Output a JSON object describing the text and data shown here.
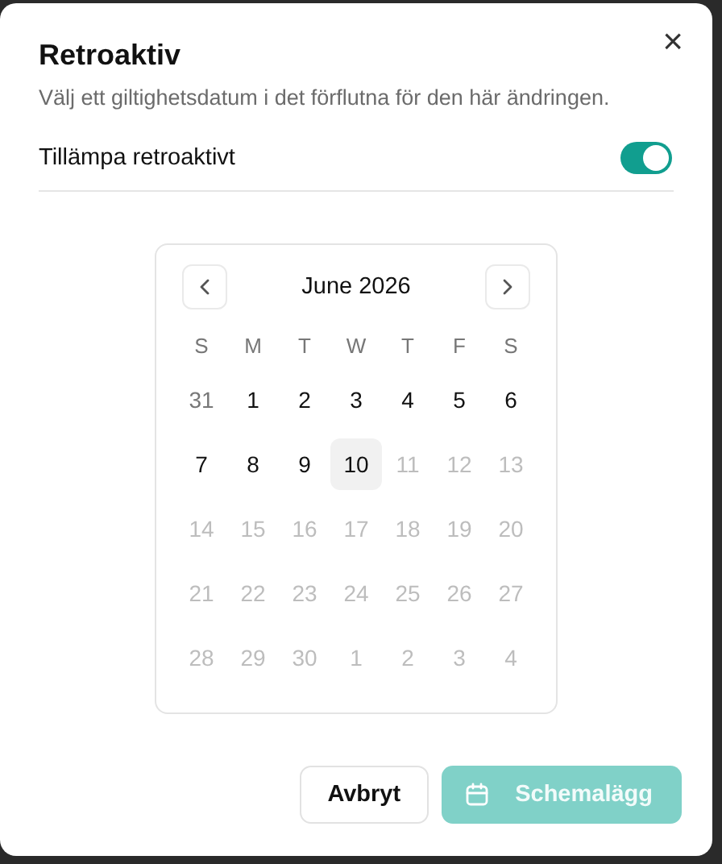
{
  "dialog": {
    "title": "Retroaktiv",
    "description": "Välj ett giltighetsdatum i det förflutna för den här ändringen.",
    "close": "×"
  },
  "toggle": {
    "label": "Tillämpa retroaktivt",
    "on": true
  },
  "calendar": {
    "month": "June 2026",
    "weekdays": [
      "S",
      "M",
      "T",
      "W",
      "T",
      "F",
      "S"
    ],
    "days": [
      {
        "label": "31",
        "outside": true,
        "disabled": false,
        "selected": false
      },
      {
        "label": "1",
        "outside": false,
        "disabled": false,
        "selected": false
      },
      {
        "label": "2",
        "outside": false,
        "disabled": false,
        "selected": false
      },
      {
        "label": "3",
        "outside": false,
        "disabled": false,
        "selected": false
      },
      {
        "label": "4",
        "outside": false,
        "disabled": false,
        "selected": false
      },
      {
        "label": "5",
        "outside": false,
        "disabled": false,
        "selected": false
      },
      {
        "label": "6",
        "outside": false,
        "disabled": false,
        "selected": false
      },
      {
        "label": "7",
        "outside": false,
        "disabled": false,
        "selected": false
      },
      {
        "label": "8",
        "outside": false,
        "disabled": false,
        "selected": false
      },
      {
        "label": "9",
        "outside": false,
        "disabled": false,
        "selected": false
      },
      {
        "label": "10",
        "outside": false,
        "disabled": false,
        "selected": true
      },
      {
        "label": "11",
        "outside": false,
        "disabled": true,
        "selected": false
      },
      {
        "label": "12",
        "outside": false,
        "disabled": true,
        "selected": false
      },
      {
        "label": "13",
        "outside": false,
        "disabled": true,
        "selected": false
      },
      {
        "label": "14",
        "outside": false,
        "disabled": true,
        "selected": false
      },
      {
        "label": "15",
        "outside": false,
        "disabled": true,
        "selected": false
      },
      {
        "label": "16",
        "outside": false,
        "disabled": true,
        "selected": false
      },
      {
        "label": "17",
        "outside": false,
        "disabled": true,
        "selected": false
      },
      {
        "label": "18",
        "outside": false,
        "disabled": true,
        "selected": false
      },
      {
        "label": "19",
        "outside": false,
        "disabled": true,
        "selected": false
      },
      {
        "label": "20",
        "outside": false,
        "disabled": true,
        "selected": false
      },
      {
        "label": "21",
        "outside": false,
        "disabled": true,
        "selected": false
      },
      {
        "label": "22",
        "outside": false,
        "disabled": true,
        "selected": false
      },
      {
        "label": "23",
        "outside": false,
        "disabled": true,
        "selected": false
      },
      {
        "label": "24",
        "outside": false,
        "disabled": true,
        "selected": false
      },
      {
        "label": "25",
        "outside": false,
        "disabled": true,
        "selected": false
      },
      {
        "label": "26",
        "outside": false,
        "disabled": true,
        "selected": false
      },
      {
        "label": "27",
        "outside": false,
        "disabled": true,
        "selected": false
      },
      {
        "label": "28",
        "outside": false,
        "disabled": true,
        "selected": false
      },
      {
        "label": "29",
        "outside": false,
        "disabled": true,
        "selected": false
      },
      {
        "label": "30",
        "outside": false,
        "disabled": true,
        "selected": false
      },
      {
        "label": "1",
        "outside": true,
        "disabled": true,
        "selected": false
      },
      {
        "label": "2",
        "outside": true,
        "disabled": true,
        "selected": false
      },
      {
        "label": "3",
        "outside": true,
        "disabled": true,
        "selected": false
      },
      {
        "label": "4",
        "outside": true,
        "disabled": true,
        "selected": false
      }
    ]
  },
  "buttons": [
    {
      "label": "Avbryt",
      "kind": "secondary",
      "disabled": false
    },
    {
      "label": "Schemalägg",
      "kind": "primary",
      "disabled": true
    }
  ]
}
